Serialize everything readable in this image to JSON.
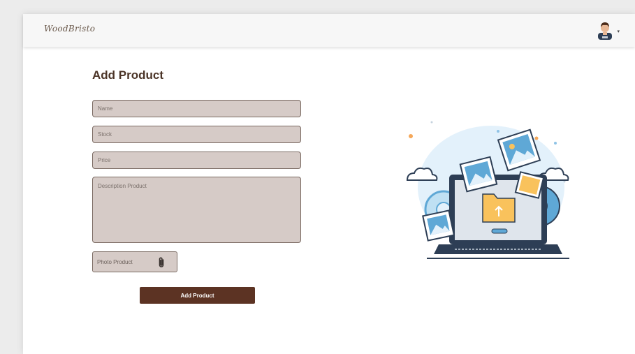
{
  "brand": {
    "logo_text": "WoodBristo"
  },
  "form": {
    "title": "Add Product",
    "name_placeholder": "Name",
    "stock_placeholder": "Stock",
    "price_placeholder": "Price",
    "description_placeholder": "Description Product",
    "photo_label": "Photo Product",
    "submit_label": "Add Product"
  },
  "icons": {
    "user": "user-avatar-icon",
    "menu_caret": "caret-down-icon",
    "attach": "paperclip-icon",
    "illustration": "upload-illustration"
  },
  "colors": {
    "title": "#4b3427",
    "field_bg": "#d6cbc7",
    "field_border": "#7a6a62",
    "button_bg": "#5c3323",
    "button_text": "#ffffff"
  }
}
